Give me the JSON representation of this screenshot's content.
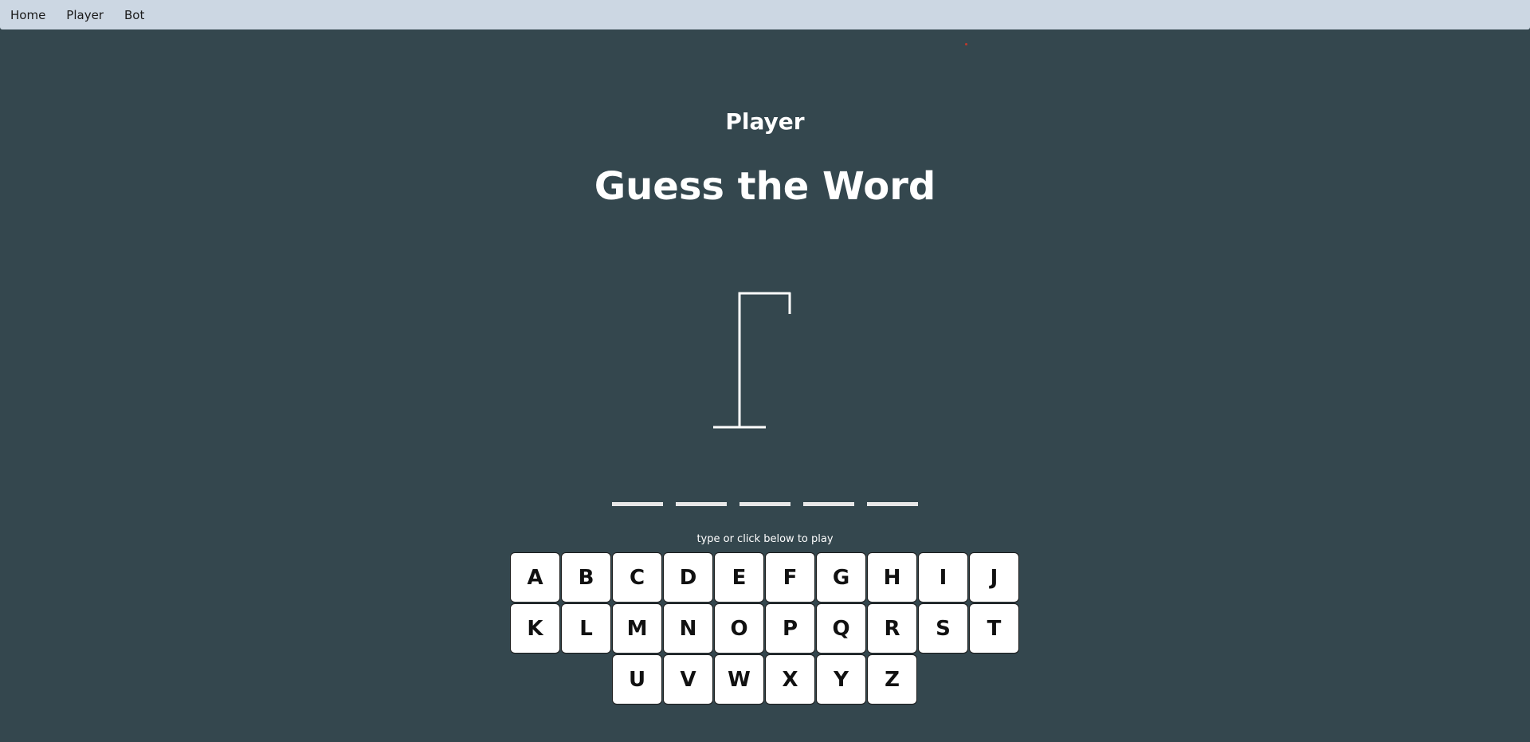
{
  "nav": {
    "links": [
      {
        "label": "Home"
      },
      {
        "label": "Player"
      },
      {
        "label": "Bot"
      }
    ]
  },
  "header": {
    "subtitle": "Player",
    "title": "Guess the Word"
  },
  "word": {
    "blank_count": 5
  },
  "hint": "type or click below to play",
  "keyboard": {
    "rows": [
      [
        "A",
        "B",
        "C",
        "D",
        "E",
        "F",
        "G",
        "H",
        "I",
        "J"
      ],
      [
        "K",
        "L",
        "M",
        "N",
        "O",
        "P",
        "Q",
        "R",
        "S",
        "T"
      ],
      [
        "U",
        "V",
        "W",
        "X",
        "Y",
        "Z"
      ]
    ]
  },
  "colors": {
    "background": "#34474e",
    "navbar": "#ccd7e3",
    "key_bg": "#ffffff",
    "gallows": "#ffffff"
  },
  "icons": {
    "gallows": "gallows-icon"
  }
}
